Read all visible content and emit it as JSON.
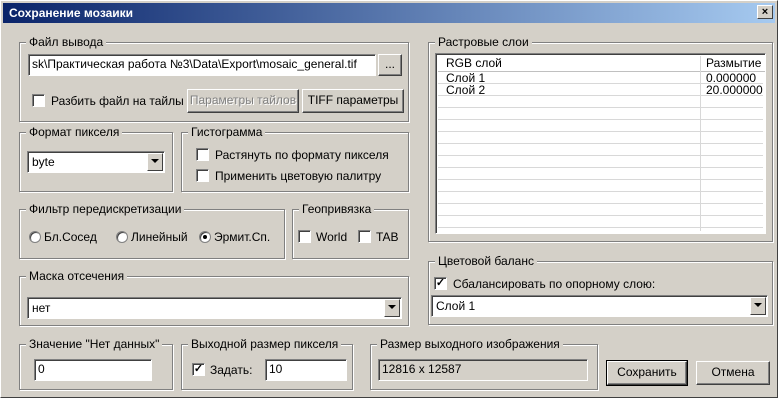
{
  "window": {
    "title": "Сохранение мозаики",
    "close_glyph": "×"
  },
  "output_file": {
    "legend": "Файл вывода",
    "path": "sk\\Практическая работа №3\\Data\\Export\\mosaic_general.tif",
    "browse_label": "...",
    "split_label": "Разбить файл на тайлы",
    "split_checked": false,
    "tile_params_label": "Параметры тайлов",
    "tiff_params_label": "TIFF параметры"
  },
  "pixel_format": {
    "legend": "Формат пикселя",
    "value": "byte"
  },
  "histogram": {
    "legend": "Гистограмма",
    "stretch_label": "Растянуть по формату пикселя",
    "palette_label": "Применить цветовую палитру"
  },
  "resample": {
    "legend": "Фильтр передискретизации",
    "options": [
      "Бл.Сосед",
      "Линейный",
      "Эрмит.Сп."
    ],
    "selected_index": 2
  },
  "georef": {
    "legend": "Геопривязка",
    "world_label": "World",
    "tab_label": "TAB"
  },
  "mask": {
    "legend": "Маска отсечения",
    "value": "нет"
  },
  "nodata": {
    "legend": "Значение \"Нет данных\"",
    "value": "0"
  },
  "pixel_size": {
    "legend": "Выходной размер пикселя",
    "set_label": "Задать:",
    "set_checked": true,
    "value": "10"
  },
  "output_size": {
    "legend": "Размер выходного изображения",
    "value": "12816 x 12587"
  },
  "raster_layers": {
    "legend": "Растровые слои",
    "columns": [
      "RGB слой",
      "Размытие"
    ],
    "rows": [
      [
        "Слой 1",
        "0.000000"
      ],
      [
        "Слой 2",
        "20.000000"
      ]
    ],
    "empty_rows": 11
  },
  "color_balance": {
    "legend": "Цветовой баланс",
    "balance_label": "Сбалансировать по опорному слою:",
    "balance_checked": true,
    "layer": "Слой 1"
  },
  "buttons": {
    "save": "Сохранить",
    "cancel": "Отмена"
  },
  "check_glyph": "✓"
}
